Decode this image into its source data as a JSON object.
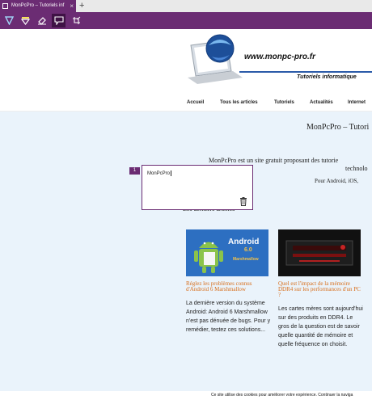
{
  "browser": {
    "tab_title": "MonPcPro – Tutoriels inf",
    "tab_close": "×",
    "new_tab": "+"
  },
  "notes_toolbar": {
    "tools": [
      "pen-tool",
      "highlighter-tool",
      "eraser-tool",
      "comment-tool",
      "clip-tool"
    ],
    "active_tool": "comment-tool",
    "accent_color": "#6b2c73"
  },
  "site": {
    "logo_url": "www.monpc-pro.fr",
    "logo_tagline": "Tutoriels informatique",
    "nav": [
      "Accueil",
      "Tous les articles",
      "Tutoriels",
      "Actualités",
      "Internet"
    ],
    "title": "MonPcPro – Tutori",
    "intro_line1": "MonPcPro est un site gratuit proposant des tutorie",
    "intro_line2": "technolo",
    "intro_platforms": "Pour Android, iOS, ",
    "latest_heading": "Les derniers articles",
    "articles": [
      {
        "thumb_text": [
          "Android",
          "6.0",
          "Marshmallow"
        ],
        "title": "Réglez les problèmes connus d'Android 6 Marshmallow",
        "excerpt": "La dernière version du système Android: Android 6 Marshmallow n'est pas dénuée de bugs. Pour y remédier, testez ces solutions..."
      },
      {
        "title": "Quel est l'impact de la mémoire DDR4 sur les performances d'un PC ?",
        "excerpt": "Les cartes mères sont aujourd'hui sur des produits en DDR4. Le gros de la question est de savoir quelle quantité de mémoire et quelle fréquence on choisit."
      }
    ],
    "cookie_notice": "Ce site utilise des cookies pour améliorer votre expérience. Continuer la naviga"
  },
  "note": {
    "number": "1",
    "text": "MonPcPro"
  }
}
